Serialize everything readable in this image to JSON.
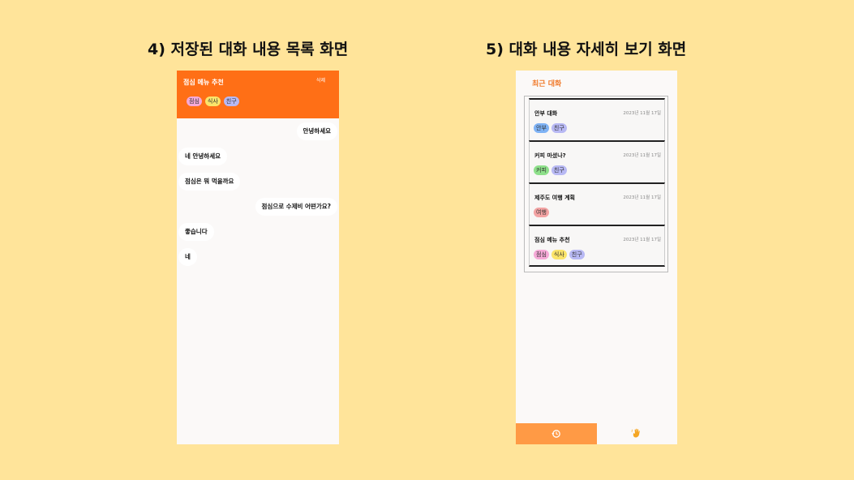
{
  "headings": {
    "left": "4) 저장된 대화 내용 목록 화면",
    "right": "5) 대화 내용 자세히 보기 화면"
  },
  "chat": {
    "title": "점심 메뉴 추천",
    "delete_label": "삭제",
    "tags": [
      {
        "label": "점심",
        "color": "#F6A9D7"
      },
      {
        "label": "식사",
        "color": "#FBE46A"
      },
      {
        "label": "친구",
        "color": "#B8B9F4"
      }
    ],
    "messages": [
      {
        "side": "right",
        "text": "안녕하세요"
      },
      {
        "side": "left",
        "text": "네 안녕하세요"
      },
      {
        "side": "left",
        "text": "점심은 뭐 먹을까요"
      },
      {
        "side": "right",
        "text": "점심으로 수제비 어떤가요?"
      },
      {
        "side": "left",
        "text": "좋습니다"
      },
      {
        "side": "left",
        "text": "네"
      }
    ]
  },
  "list": {
    "title": "최근 대화",
    "items": [
      {
        "title": "안부 대화",
        "date": "2023년 11월 17일",
        "tags": [
          {
            "label": "안부",
            "color": "#7FB3F5"
          },
          {
            "label": "친구",
            "color": "#B8B9F4"
          }
        ]
      },
      {
        "title": "커피 마셨나?",
        "date": "2023년 11월 17일",
        "tags": [
          {
            "label": "커피",
            "color": "#8EE08A"
          },
          {
            "label": "친구",
            "color": "#B8B9F4"
          }
        ]
      },
      {
        "title": "제주도 여행 계획",
        "date": "2023년 11월 17일",
        "tags": [
          {
            "label": "여행",
            "color": "#F3A3A3"
          }
        ]
      },
      {
        "title": "점심 메뉴 추천",
        "date": "2023년 11월 17일",
        "tags": [
          {
            "label": "점심",
            "color": "#F6A9D7"
          },
          {
            "label": "식사",
            "color": "#FBE46A"
          },
          {
            "label": "친구",
            "color": "#B8B9F4"
          }
        ]
      }
    ]
  },
  "nav": {
    "items": [
      {
        "icon": "history-icon",
        "active": true
      },
      {
        "icon": "waving-hand-icon",
        "active": false
      }
    ]
  },
  "colors": {
    "background": "#FFE49A",
    "header": "#FF6F16",
    "accent": "#F07A2B",
    "nav_active": "#FF9A45"
  }
}
